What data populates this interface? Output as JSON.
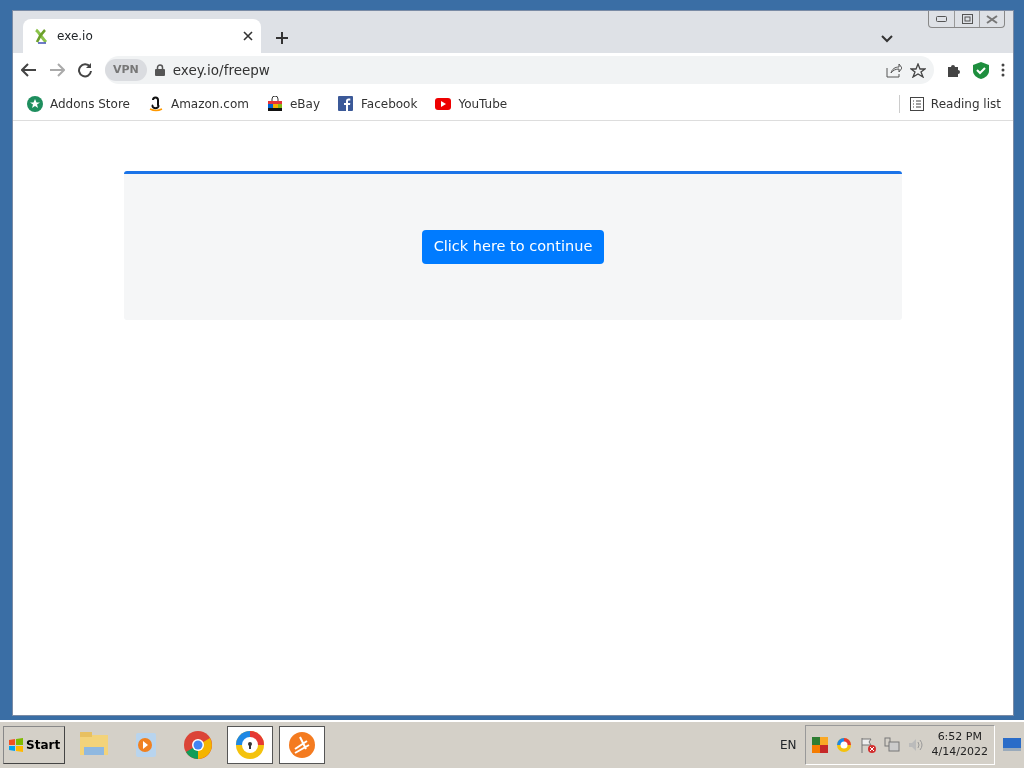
{
  "tabs": [
    {
      "title": "exe.io",
      "selected": true
    }
  ],
  "address_bar": {
    "url": "exey.io/freepw",
    "vpn_label": "VPN"
  },
  "bookmarks": [
    {
      "label": "Addons Store",
      "kind": "addons"
    },
    {
      "label": "Amazon.com",
      "kind": "amazon"
    },
    {
      "label": "eBay",
      "kind": "ebay"
    },
    {
      "label": "Facebook",
      "kind": "facebook"
    },
    {
      "label": "YouTube",
      "kind": "youtube"
    }
  ],
  "reading_list": "Reading list",
  "page": {
    "button": "Click here to continue"
  },
  "taskbar": {
    "start": "Start",
    "apps": [
      {
        "kind": "folder",
        "selected": false
      },
      {
        "kind": "media",
        "selected": false
      },
      {
        "kind": "chrome",
        "selected": false
      },
      {
        "kind": "browser",
        "selected": true
      },
      {
        "kind": "avast",
        "selected": true
      }
    ],
    "language": "EN",
    "time": "6:52 PM",
    "date": "4/14/2022"
  }
}
